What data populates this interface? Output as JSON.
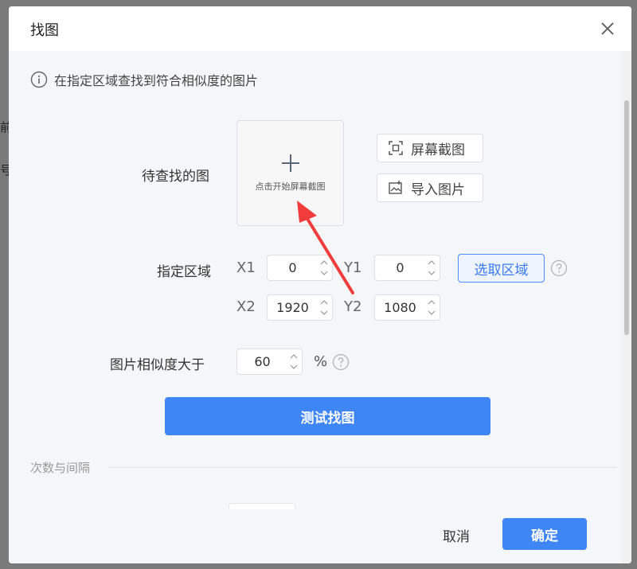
{
  "backdrop": {
    "text1": "前",
    "text2": "号"
  },
  "dialog": {
    "title": "找图",
    "hint": "在指定区域查找到符合相似度的图片",
    "target_image": {
      "label": "待查找的图",
      "upload_text": "点击开始屏幕截图",
      "screenshot_button": "屏幕截图",
      "import_button": "导入图片"
    },
    "region": {
      "label": "指定区域",
      "x1_label": "X1",
      "x1_value": "0",
      "y1_label": "Y1",
      "y1_value": "0",
      "x2_label": "X2",
      "x2_value": "1920",
      "y2_label": "Y2",
      "y2_value": "1080",
      "select_button": "选取区域"
    },
    "similarity": {
      "label": "图片相似度大于",
      "value": "60",
      "unit": "%"
    },
    "test_button": "测试找图",
    "section_title": "次数与间隔",
    "footer": {
      "cancel": "取消",
      "ok": "确定"
    }
  },
  "colors": {
    "primary": "#3e86f5",
    "annotation_arrow": "#f23c3c"
  },
  "icons": [
    "info-icon",
    "close-icon",
    "plus-icon",
    "screenshot-icon",
    "image-import-icon",
    "help-icon",
    "spin-up-icon",
    "spin-down-icon"
  ]
}
